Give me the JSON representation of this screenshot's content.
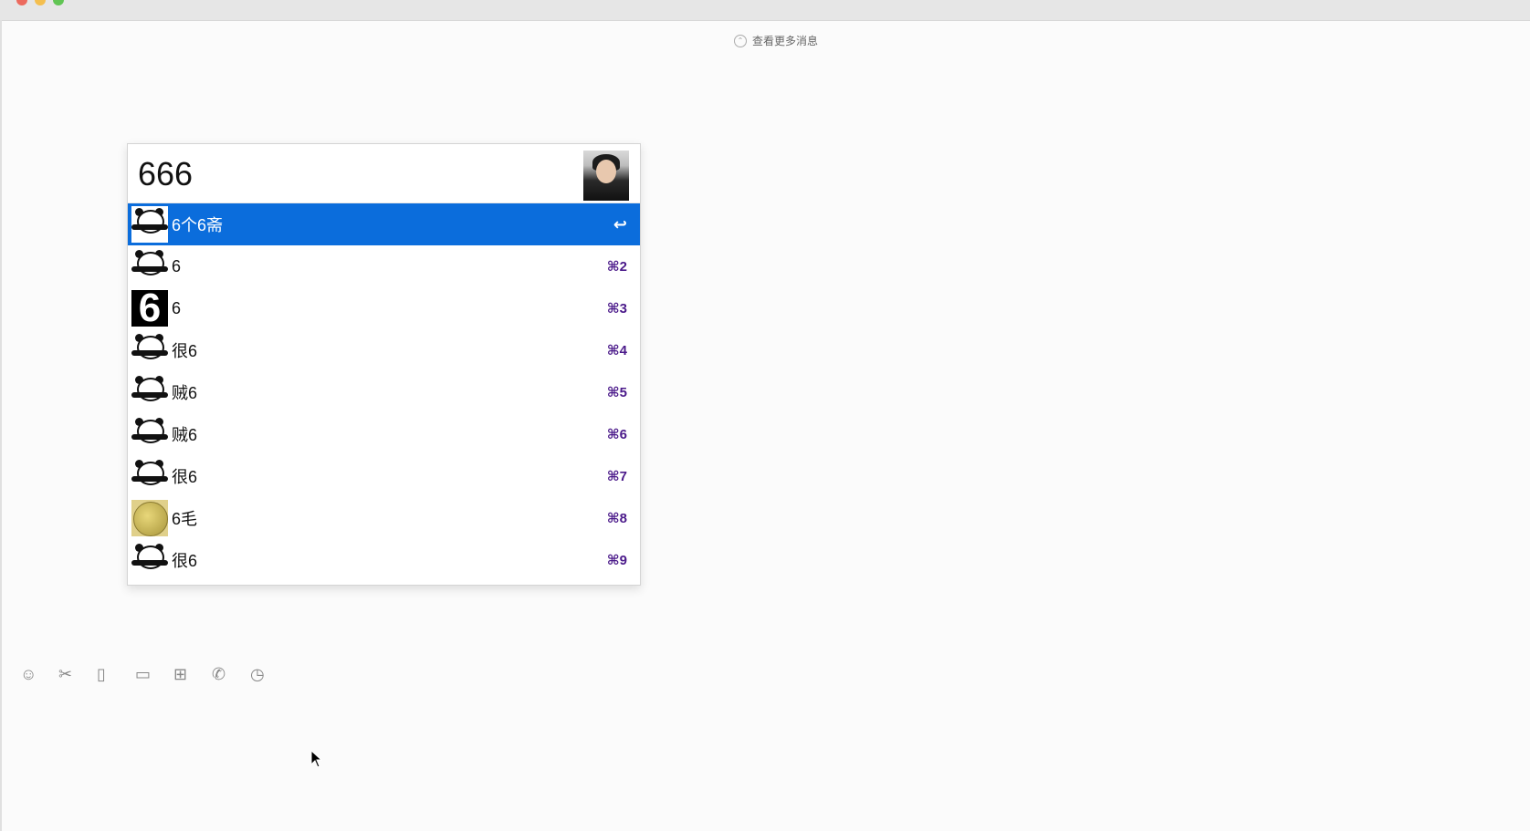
{
  "window": {
    "title": "",
    "colors": {
      "selection": "#0b6ddc",
      "shortcut": "#4b1a8a"
    }
  },
  "chat": {
    "more_messages_label": "查看更多消息"
  },
  "popup": {
    "search_text": "666",
    "items": [
      {
        "label": "6个6斋",
        "shortcut": "↩",
        "thumb": "panda",
        "selected": true
      },
      {
        "label": "6",
        "shortcut": "⌘2",
        "thumb": "panda",
        "selected": false
      },
      {
        "label": "6",
        "shortcut": "⌘3",
        "thumb": "six",
        "selected": false
      },
      {
        "label": "很6",
        "shortcut": "⌘4",
        "thumb": "panda",
        "selected": false
      },
      {
        "label": "贼6",
        "shortcut": "⌘5",
        "thumb": "panda",
        "selected": false
      },
      {
        "label": "贼6",
        "shortcut": "⌘6",
        "thumb": "panda",
        "selected": false
      },
      {
        "label": "很6",
        "shortcut": "⌘7",
        "thumb": "panda",
        "selected": false
      },
      {
        "label": "6毛",
        "shortcut": "⌘8",
        "thumb": "coin",
        "selected": false
      },
      {
        "label": "很6",
        "shortcut": "⌘9",
        "thumb": "panda",
        "selected": false
      }
    ]
  },
  "toolbar": {
    "icons": [
      "emoji-icon",
      "scissors-icon",
      "phone-screen-icon",
      "folder-icon",
      "gift-icon",
      "phone-call-icon",
      "clock-icon"
    ]
  }
}
